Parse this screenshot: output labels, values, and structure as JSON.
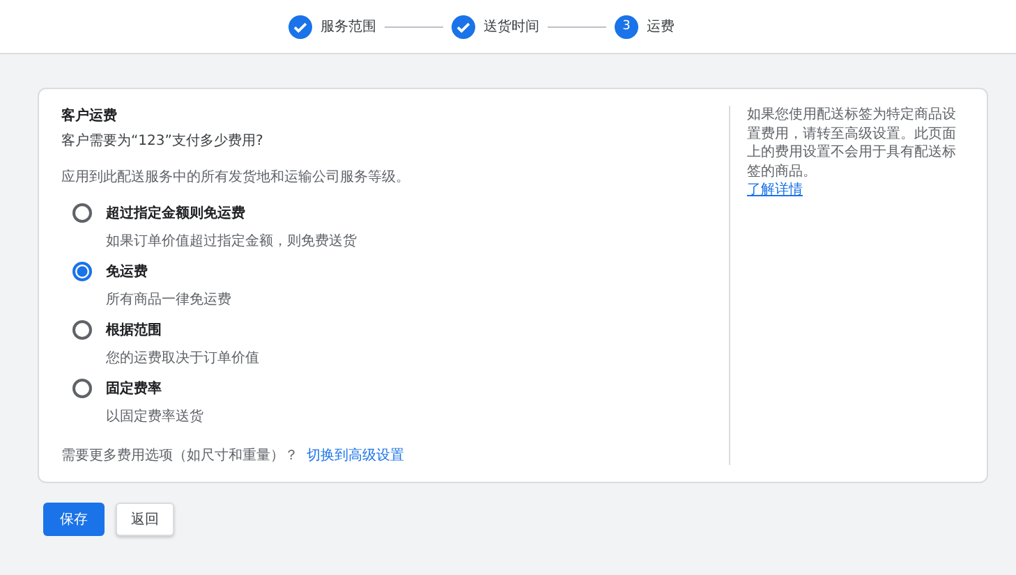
{
  "steps": [
    {
      "label": "服务范围",
      "completed": true
    },
    {
      "label": "送货时间",
      "completed": true
    },
    {
      "label": "运费",
      "completed": false,
      "number": "3"
    }
  ],
  "card": {
    "title": "客户运费",
    "question": "客户需要为“123”支付多少费用?",
    "description": "应用到此配送服务中的所有发货地和运输公司服务等级。",
    "options": [
      {
        "label": "超过指定金额则免运费",
        "hint": "如果订单价值超过指定金额，则免费送货",
        "selected": false
      },
      {
        "label": "免运费",
        "hint": "所有商品一律免运费",
        "selected": true
      },
      {
        "label": "根据范围",
        "hint": "您的运费取决于订单价值",
        "selected": false
      },
      {
        "label": "固定费率",
        "hint": "以固定费率送货",
        "selected": false
      }
    ],
    "more_text": "需要更多费用选项（如尺寸和重量）？",
    "more_link": "切换到高级设置",
    "note": "如果您使用配送标签为特定商品设置费用，请转至高级设置。此页面上的费用设置不会用于具有配送标签的商品。",
    "note_link": "了解详情"
  },
  "buttons": {
    "save": "保存",
    "back": "返回"
  }
}
